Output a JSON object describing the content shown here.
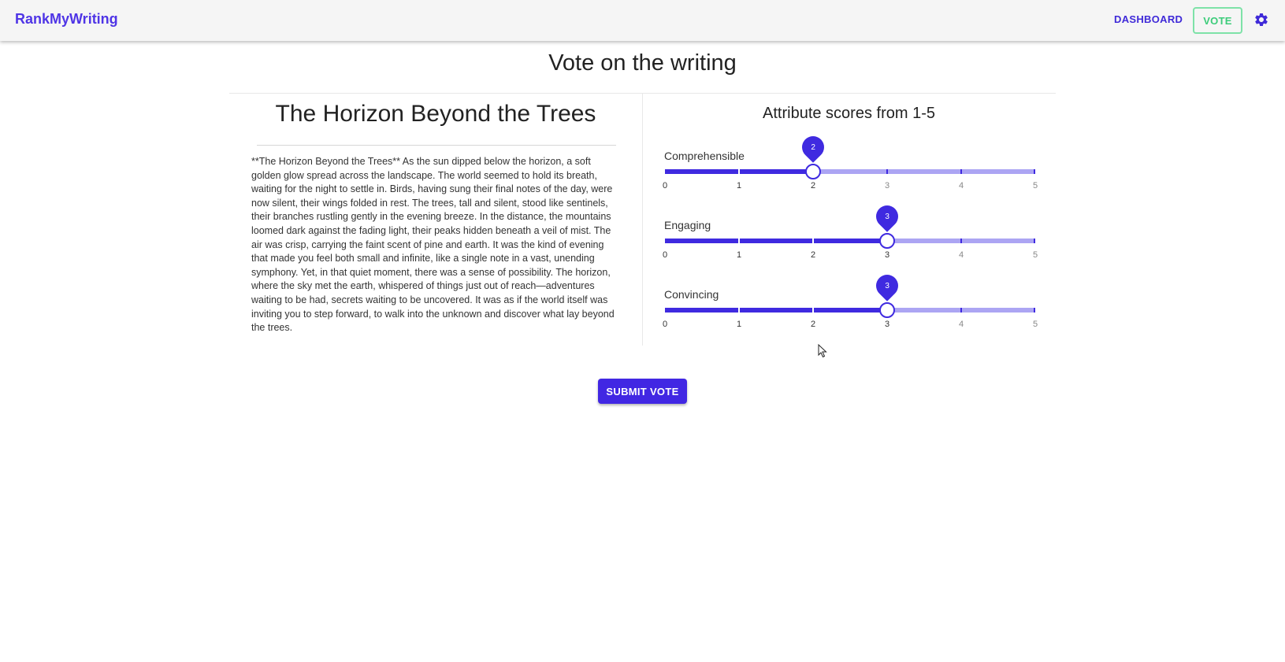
{
  "app": {
    "brand": "RankMyWriting",
    "nav": {
      "dashboard": "DASHBOARD",
      "vote": "VOTE"
    },
    "icons": {
      "settings": "gear-icon"
    },
    "colors": {
      "primary": "#3f2ae0",
      "track_light": "#aca5f3",
      "vote_accent": "#3ccc7a",
      "vote_border": "#7ee2a8"
    }
  },
  "page": {
    "title": "Vote on the writing"
  },
  "writing": {
    "title": "The Horizon Beyond the Trees",
    "body": "**The Horizon Beyond the Trees** As the sun dipped below the horizon, a soft golden glow spread across the landscape. The world seemed to hold its breath, waiting for the night to settle in. Birds, having sung their final notes of the day, were now silent, their wings folded in rest. The trees, tall and silent, stood like sentinels, their branches rustling gently in the evening breeze. In the distance, the mountains loomed dark against the fading light, their peaks hidden beneath a veil of mist. The air was crisp, carrying the faint scent of pine and earth. It was the kind of evening that made you feel both small and infinite, like a single note in a vast, unending symphony. Yet, in that quiet moment, there was a sense of possibility. The horizon, where the sky met the earth, whispered of things just out of reach—adventures waiting to be had, secrets waiting to be uncovered. It was as if the world itself was inviting you to step forward, to walk into the unknown and discover what lay beyond the trees."
  },
  "scores": {
    "heading": "Attribute scores from 1-5",
    "min": 0,
    "max": 5,
    "tick_labels": [
      "0",
      "1",
      "2",
      "3",
      "4",
      "5"
    ],
    "attributes": [
      {
        "label": "Comprehensible",
        "value": 2,
        "value_text": "2"
      },
      {
        "label": "Engaging",
        "value": 3,
        "value_text": "3"
      },
      {
        "label": "Convincing",
        "value": 3,
        "value_text": "3"
      }
    ]
  },
  "actions": {
    "submit": "SUBMIT VOTE"
  }
}
